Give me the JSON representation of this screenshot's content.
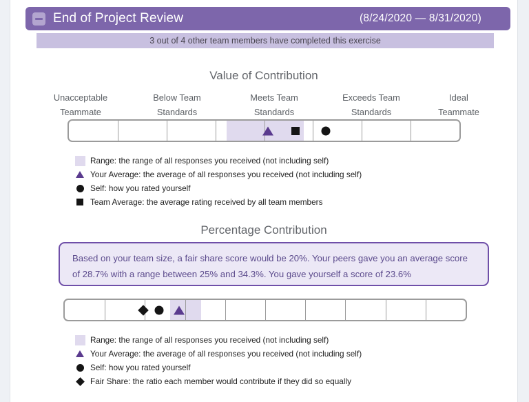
{
  "header": {
    "collapse_icon": "minus-icon",
    "title": "End of Project Review",
    "date_range": "(8/24/2020 — 8/31/2020)",
    "bar_color": "#7d66ab",
    "icon_color": "#b3a5cf"
  },
  "subheader": {
    "text": "3 out of 4 other team members have completed this exercise",
    "bg_color": "#c8c0e0"
  },
  "sections": {
    "value": {
      "title": "Value of Contribution",
      "scale_labels": [
        {
          "line1": "Unacceptable",
          "line2": "Teammate"
        },
        {
          "line1": "Below Team",
          "line2": "Standards"
        },
        {
          "line1": "Meets Team",
          "line2": "Standards"
        },
        {
          "line1": "Exceeds Team",
          "line2": "Standards"
        },
        {
          "line1": "Ideal",
          "line2": "Teammate"
        }
      ],
      "legend": [
        {
          "icon": "range-swatch",
          "text": "Range: the range of all responses you received (not including self)"
        },
        {
          "icon": "triangle-marker",
          "text": "Your Average: the average of all responses you received (not including self)"
        },
        {
          "icon": "circle-marker",
          "text": "Self: how you rated yourself"
        },
        {
          "icon": "square-marker",
          "text": "Team Average: the average rating received by all team members"
        }
      ]
    },
    "percentage": {
      "title": "Percentage Contribution",
      "info_text": "Based on your team size, a fair share score would be 20%. Your peers gave you an average score of 28.7% with a range between 25% and 34.3%. You gave yourself a score of 23.6%",
      "legend": [
        {
          "icon": "range-swatch",
          "text": "Range: the range of all responses you received (not including self)"
        },
        {
          "icon": "triangle-marker",
          "text": "Your Average: the average of all responses you received (not including self)"
        },
        {
          "icon": "circle-marker",
          "text": "Self: how you rated yourself"
        },
        {
          "icon": "diamond-marker",
          "text": "Fair Share: the ratio each member would contribute if they did so equally"
        }
      ]
    }
  },
  "chart_data": [
    {
      "type": "bar",
      "title": "Value of Contribution",
      "scale": "categorical-8-cell",
      "cells": 8,
      "xlabel": "",
      "ylabel": "",
      "tick_labels": [
        "Unacceptable Teammate",
        "Below Team Standards",
        "Meets Team Standards",
        "Exceeds Team Standards",
        "Ideal Teammate"
      ],
      "range_band": {
        "start_fraction": 0.4035,
        "end_fraction": 0.6007,
        "color": "#e0daee"
      },
      "markers": [
        {
          "name": "Your Average",
          "symbol": "triangle",
          "color": "#5a3a8e",
          "fraction": 0.5096
        },
        {
          "name": "Team Average",
          "symbol": "square",
          "color": "#151515",
          "fraction": 0.5796
        },
        {
          "name": "Self",
          "symbol": "circle",
          "color": "#151515",
          "fraction": 0.6585
        }
      ]
    },
    {
      "type": "bar",
      "title": "Percentage Contribution",
      "scale": "percentage-10-cell",
      "cells": 10,
      "xlabel": "",
      "ylabel": "",
      "fair_share_pct": 20,
      "peer_average_pct": 28.7,
      "range_low_pct": 25,
      "range_high_pct": 34.3,
      "self_pct": 23.6,
      "range_band": {
        "start_fraction": 0.2628,
        "end_fraction": 0.3396,
        "color": "#e0daee"
      },
      "markers": [
        {
          "name": "Fair Share",
          "symbol": "diamond",
          "color": "#151515",
          "fraction": 0.1962
        },
        {
          "name": "Self",
          "symbol": "circle",
          "color": "#151515",
          "fraction": 0.2355
        },
        {
          "name": "Your Average",
          "symbol": "triangle",
          "color": "#5a3a8e",
          "fraction": 0.285
        }
      ]
    }
  ]
}
